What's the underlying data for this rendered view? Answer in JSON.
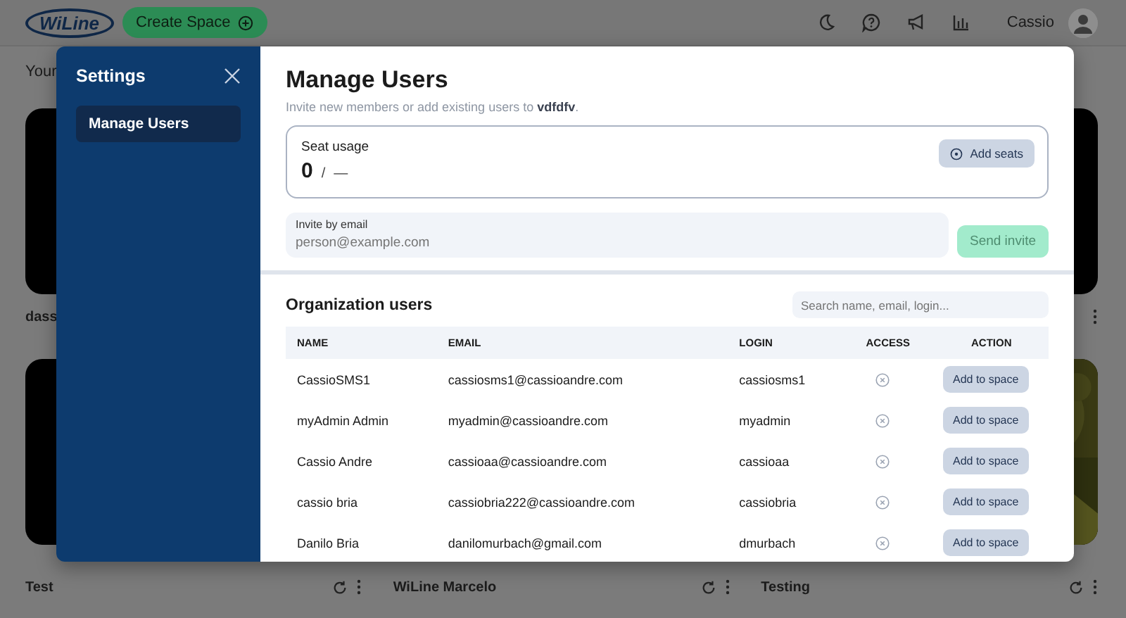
{
  "header": {
    "logo": "WiLine",
    "create_button": "Create Space",
    "user_name": "Cassio"
  },
  "page": {
    "heading": "Your",
    "cards": [
      {
        "kind": "black",
        "name": "dass"
      },
      {
        "kind": "covered"
      },
      {
        "kind": "black"
      },
      {
        "kind": "black",
        "name": "Test",
        "synced": true
      },
      {
        "kind": "covered",
        "name": "WiLine Marcelo",
        "synced": true
      },
      {
        "kind": "picture",
        "name": "Testing",
        "synced": true
      }
    ]
  },
  "settings": {
    "title": "Settings",
    "menu": [
      {
        "label": "Manage Users",
        "selected": true
      }
    ]
  },
  "manage": {
    "title": "Manage Users",
    "subtitle": "Invite new members or add existing users to **vdfdfv**.",
    "seat_usage": {
      "label": "Seat usage",
      "used": "0",
      "separator": "/",
      "total": "—",
      "button": "Add seats"
    },
    "invite": {
      "label": "Invite by email",
      "placeholder": "person@example.com",
      "button": "Send invite"
    },
    "org_title": "Organization users",
    "search": {
      "placeholder": "Search name, email, login..."
    },
    "table": {
      "columns": [
        "NAME",
        "EMAIL",
        "LOGIN",
        "ACCESS",
        "ACTION"
      ],
      "rows": [
        {
          "name": "CassioSMS1",
          "email": "cassiosms1@cassioandre.com",
          "login": "cassiosms1",
          "access": false,
          "action": "Add to space"
        },
        {
          "name": "myAdmin Admin",
          "email": "myadmin@cassioandre.com",
          "login": "myadmin",
          "access": false,
          "action": "Add to space"
        },
        {
          "name": "Cassio Andre",
          "email": "cassioaa@cassioandre.com",
          "login": "cassioaa",
          "access": false,
          "action": "Add to space"
        },
        {
          "name": "cassio bria",
          "email": "cassiobria222@cassioandre.com",
          "login": "cassiobria",
          "access": false,
          "action": "Add to space"
        },
        {
          "name": "Danilo Bria",
          "email": "danilomurbach@gmail.com",
          "login": "dmurbach",
          "access": false,
          "action": "Add to space"
        }
      ]
    }
  }
}
